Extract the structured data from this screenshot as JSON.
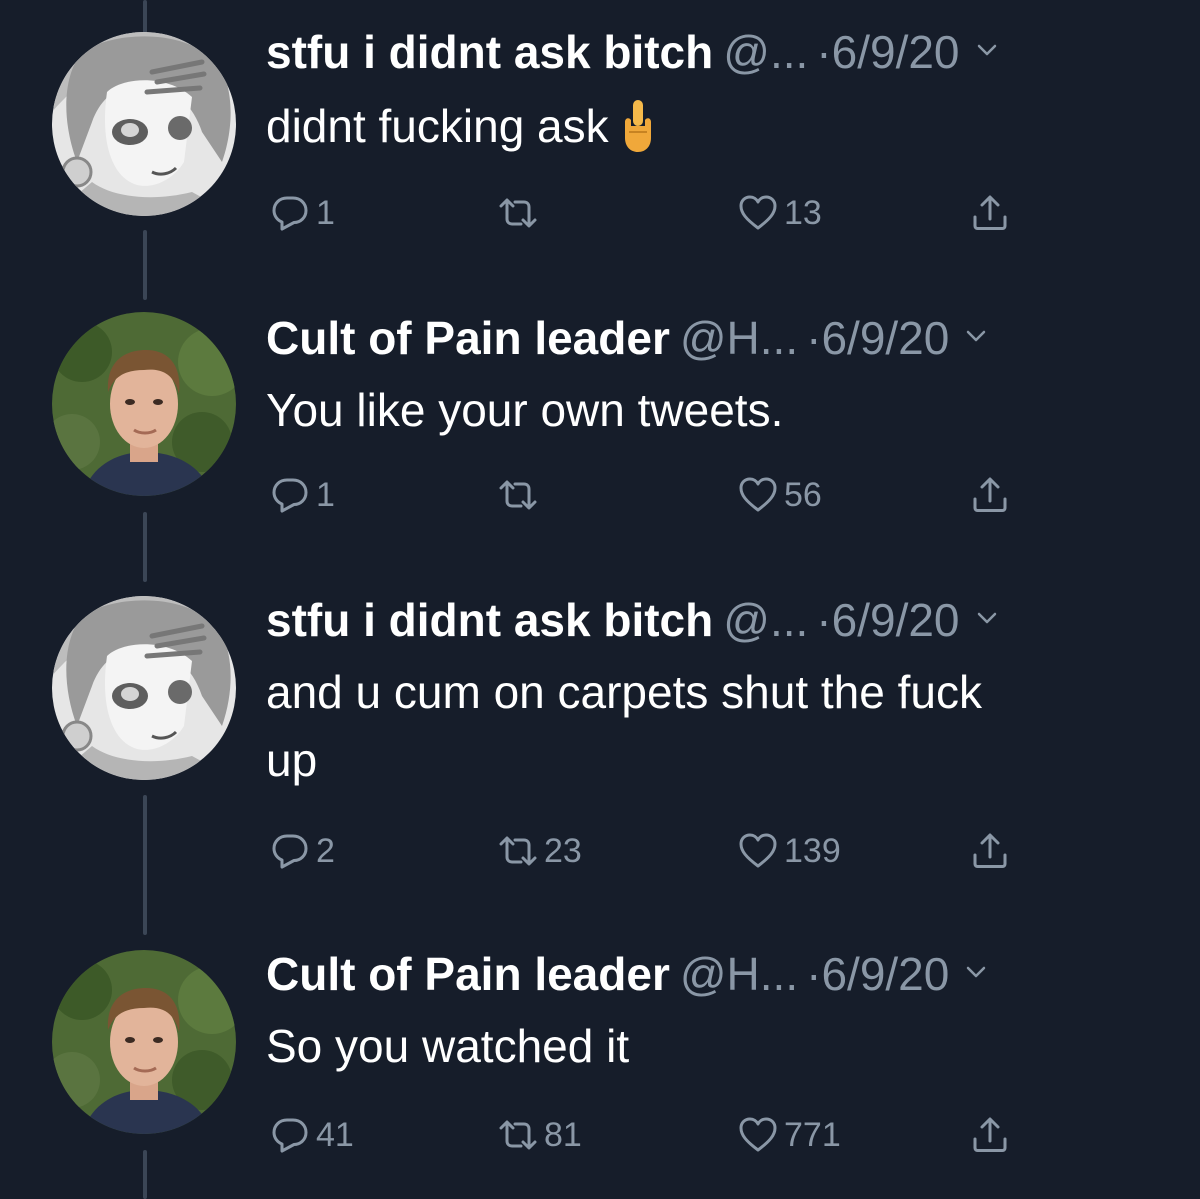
{
  "thread": {
    "tweets": [
      {
        "avatar_icon": "anime-avatar",
        "name": "stfu i didnt ask bitch",
        "handle": "@...",
        "separator": "·",
        "date": "6/9/20",
        "text": "didnt fucking ask",
        "emoji_icon": "middle-finger-emoji",
        "replies": "1",
        "retweets": "",
        "likes": "13"
      },
      {
        "avatar_icon": "person-photo-avatar",
        "name": "Cult of Pain leader",
        "handle": "@H...",
        "separator": "·",
        "date": "6/9/20",
        "text": "You like your own tweets.",
        "replies": "1",
        "retweets": "",
        "likes": "56"
      },
      {
        "avatar_icon": "anime-avatar",
        "name": "stfu i didnt ask bitch",
        "handle": "@...",
        "separator": "·",
        "date": "6/9/20",
        "text_line1": "and u cum on carpets shut the fuck",
        "text_line2": "up",
        "replies": "2",
        "retweets": "23",
        "likes": "139"
      },
      {
        "avatar_icon": "person-photo-avatar",
        "name": "Cult of Pain leader",
        "handle": "@H...",
        "separator": "·",
        "date": "6/9/20",
        "text": "So you watched it",
        "replies": "41",
        "retweets": "81",
        "likes": "771"
      }
    ]
  },
  "icons": {
    "reply": "reply-icon",
    "retweet": "retweet-icon",
    "like": "heart-icon",
    "share": "share-icon",
    "caret": "chevron-down-icon"
  },
  "colors": {
    "background": "#161d2a",
    "text": "#ffffff",
    "secondary": "#8a97a6",
    "thread_line": "#3b4656"
  }
}
